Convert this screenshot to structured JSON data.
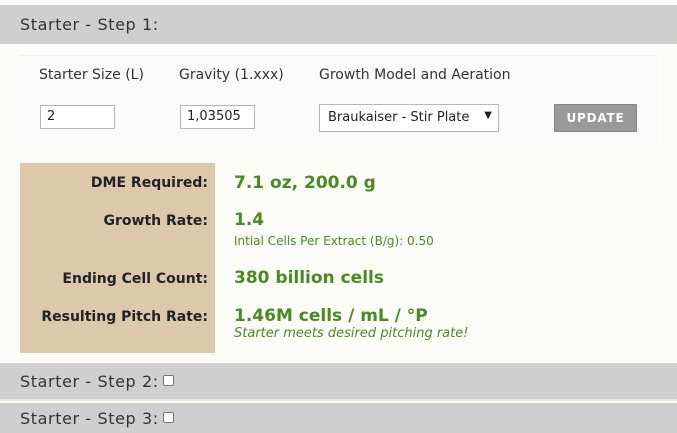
{
  "steps": [
    {
      "title": "Starter - Step 1:"
    },
    {
      "title": "Starter - Step 2:"
    },
    {
      "title": "Starter - Step 3:"
    }
  ],
  "inputs": {
    "starter_size_label": "Starter Size (L)",
    "gravity_label": "Gravity (1.xxx)",
    "growth_model_label": "Growth Model and Aeration",
    "starter_size_value": "2",
    "gravity_value": "1,03505",
    "growth_model_selected": "Braukaiser - Stir Plate",
    "update_label": "UPDATE"
  },
  "results": {
    "dme_label": "DME Required:",
    "dme_value": "7.1 oz, 200.0 g",
    "growth_label": "Growth Rate:",
    "growth_value": "1.4",
    "growth_sub": "Intial Cells Per Extract (B/g): 0.50",
    "ending_label": "Ending Cell Count:",
    "ending_value": "380 billion cells",
    "pitch_label": "Resulting Pitch Rate:",
    "pitch_value": "1.46M cells / mL / °P",
    "pitch_note": "Starter meets desired pitching rate!"
  },
  "colors": {
    "header_bg": "#cfcfcf",
    "label_col_bg": "#dcc9ab",
    "value_green": "#4a8a22",
    "button_gray": "#999999"
  }
}
